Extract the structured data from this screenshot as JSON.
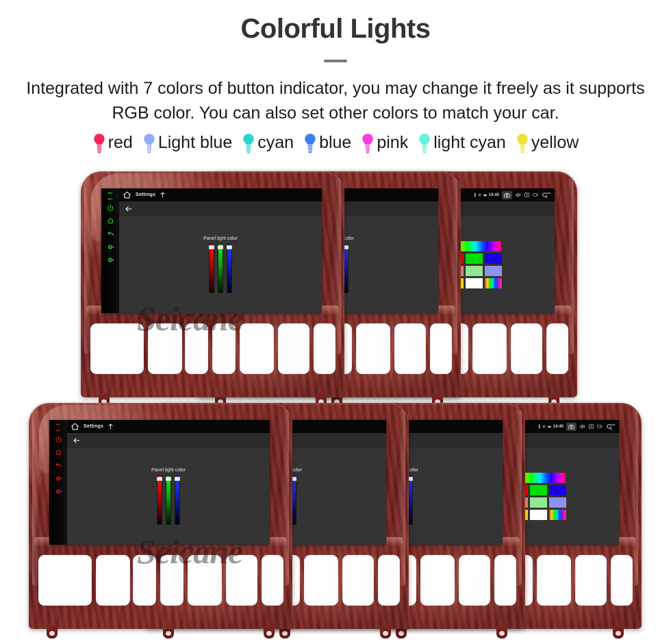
{
  "header": {
    "title": "Colorful Lights",
    "description": "Integrated with 7 colors of button indicator, you may change it freely as it supports RGB color. You can also set other colors to match your car."
  },
  "legend": {
    "items": [
      {
        "label": "red",
        "color": "#f5245f"
      },
      {
        "label": "Light blue",
        "color": "#93aaf5"
      },
      {
        "label": "cyan",
        "color": "#2ad6cd"
      },
      {
        "label": "blue",
        "color": "#3a7ff0"
      },
      {
        "label": "pink",
        "color": "#f73ce0"
      },
      {
        "label": "light cyan",
        "color": "#63f2da"
      },
      {
        "label": "yellow",
        "color": "#ebe23c"
      }
    ]
  },
  "watermark": "Seicane",
  "screen": {
    "statusbar": {
      "home_icon": "home-icon",
      "title": "Settings",
      "nav_icon": "navigation-icon",
      "clock": "14:40",
      "icons": [
        "bluetooth-icon",
        "location-icon",
        "wifi-icon",
        "screenshot-icon",
        "volume-icon",
        "back-box-icon",
        "recents-icon",
        "return-icon"
      ]
    },
    "actionbar": {
      "back_icon": "back-arrow-icon"
    },
    "panel": {
      "label": "Panel light color",
      "sliders": [
        {
          "name": "red-slider",
          "value": 100
        },
        {
          "name": "green-slider",
          "value": 100
        },
        {
          "name": "blue-slider",
          "value": 100
        }
      ]
    },
    "palette": {
      "gradient_strip": "rainbow-spectrum",
      "swatches": [
        "#ff0000",
        "#00dd00",
        "#1500e6",
        "#f98680",
        "#92e891",
        "#8f92f0",
        "#ffea00",
        "#ffffff",
        "rainbow"
      ]
    },
    "side_buttons": {
      "labels": [
        "MIC",
        "RST"
      ],
      "icons": [
        "power-icon",
        "home-icon",
        "back-icon",
        "volume-down-icon",
        "volume-up-icon"
      ]
    }
  },
  "units": [
    {
      "name": "unit-green-top",
      "button_color": "#2ff02f",
      "show_palette": false,
      "show_statusbar_right": false
    },
    {
      "name": "unit-blue-top",
      "button_color": "#4a5cf5",
      "show_palette": false,
      "show_statusbar_right": false
    },
    {
      "name": "unit-yellow-top",
      "button_color": "#ffd400",
      "show_palette": true,
      "show_statusbar_right": true
    },
    {
      "name": "unit-red-bottom",
      "button_color": "#ff1f1f",
      "show_palette": false,
      "show_statusbar_right": false
    },
    {
      "name": "unit-green-bottom",
      "button_color": "#2ff02f",
      "show_palette": false,
      "show_statusbar_right": false
    },
    {
      "name": "unit-blue-bottom",
      "button_color": "#2a4cff",
      "show_palette": false,
      "show_statusbar_right": false
    },
    {
      "name": "unit-red2-bottom",
      "button_color": "#ff2a2a",
      "show_palette": true,
      "show_statusbar_right": true
    }
  ]
}
